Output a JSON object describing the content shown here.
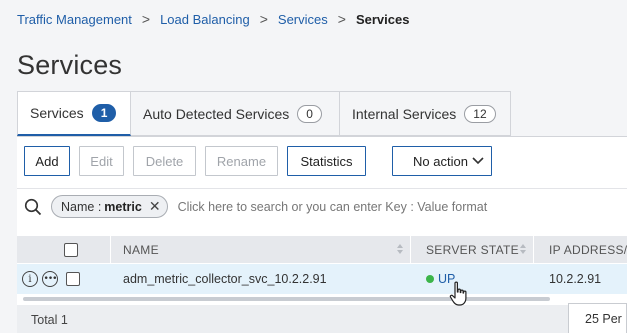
{
  "breadcrumb": {
    "items": [
      "Traffic Management",
      "Load Balancing",
      "Services"
    ],
    "current": "Services",
    "separator": ">"
  },
  "page": {
    "title": "Services"
  },
  "tabs": [
    {
      "label": "Services",
      "count": "1",
      "active": true
    },
    {
      "label": "Auto Detected Services",
      "count": "0",
      "active": false
    },
    {
      "label": "Internal Services",
      "count": "12",
      "active": false
    }
  ],
  "toolbar": {
    "add": "Add",
    "edit": "Edit",
    "delete": "Delete",
    "rename": "Rename",
    "statistics": "Statistics",
    "action_select": "No action"
  },
  "search": {
    "chip_key": "Name :",
    "chip_value": "metric",
    "chip_close": "✕",
    "placeholder": "Click here to search or you can enter Key : Value format"
  },
  "table": {
    "columns": [
      "NAME",
      "SERVER STATE",
      "IP ADDRESS/D"
    ],
    "rows": [
      {
        "name": "adm_metric_collector_svc_10.2.2.91",
        "server_state": "UP",
        "ip_address": "10.2.2.91"
      }
    ]
  },
  "footer": {
    "total": "Total 1",
    "per_page": "25 Per"
  },
  "colors": {
    "accent": "#1f5ea8",
    "status_up": "#3cb54a",
    "row_highlight": "#e4f2fb"
  }
}
